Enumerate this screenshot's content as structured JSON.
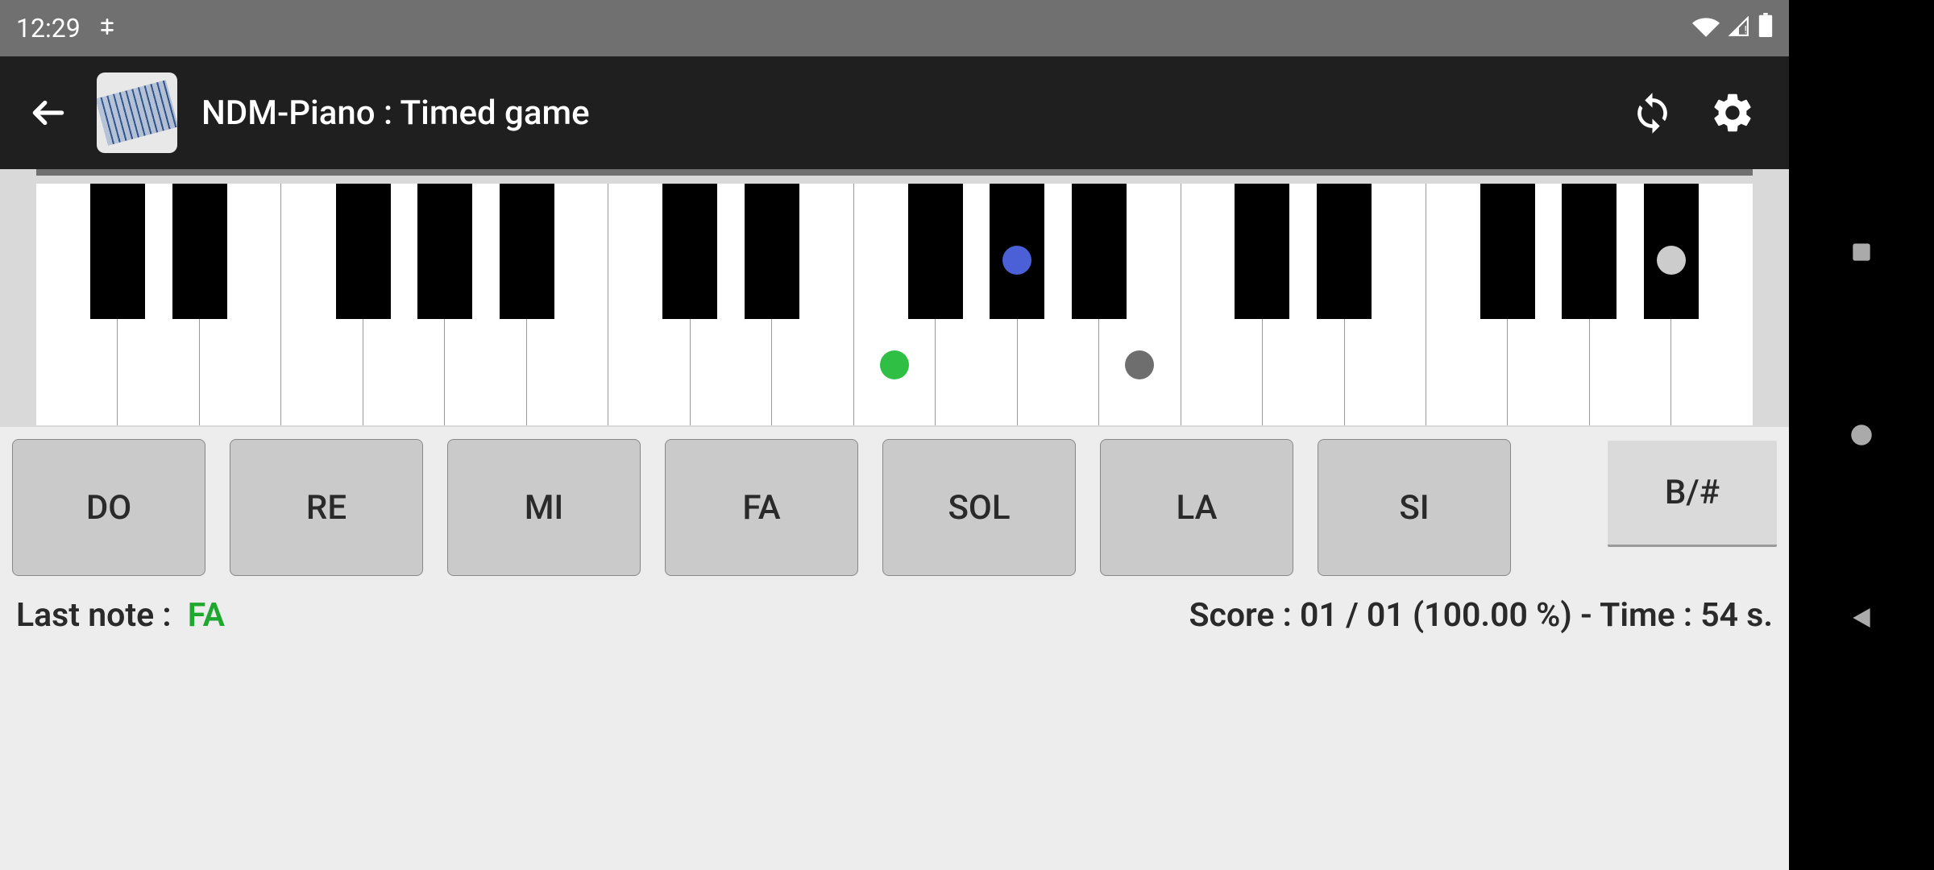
{
  "status_bar": {
    "time": "12:29"
  },
  "header": {
    "title": "NDM-Piano : Timed game"
  },
  "piano": {
    "white_key_count": 21,
    "black_key_positions": [
      0,
      1,
      3,
      4,
      5,
      7,
      8,
      10,
      11,
      12,
      14,
      15,
      17,
      18,
      19
    ],
    "markers": [
      {
        "type": "green",
        "color": "#2fbf45",
        "key_index": 10,
        "on_black": false
      },
      {
        "type": "blue",
        "color": "#4b5fd6",
        "black_key_index": 8,
        "on_black": true
      },
      {
        "type": "gray",
        "color": "#6e6e6e",
        "key_index": 13,
        "on_black": false
      },
      {
        "type": "lightgray",
        "color": "#cccccc",
        "black_key_index": 14,
        "on_black": true
      }
    ]
  },
  "note_buttons": [
    "DO",
    "RE",
    "MI",
    "FA",
    "SOL",
    "LA",
    "SI"
  ],
  "alt_button": "B/#",
  "status": {
    "last_note_label": "Last note :",
    "last_note_value": "FA",
    "score_text": "Score :  01 / 01 (100.00 %)  - Time :  54  s."
  }
}
